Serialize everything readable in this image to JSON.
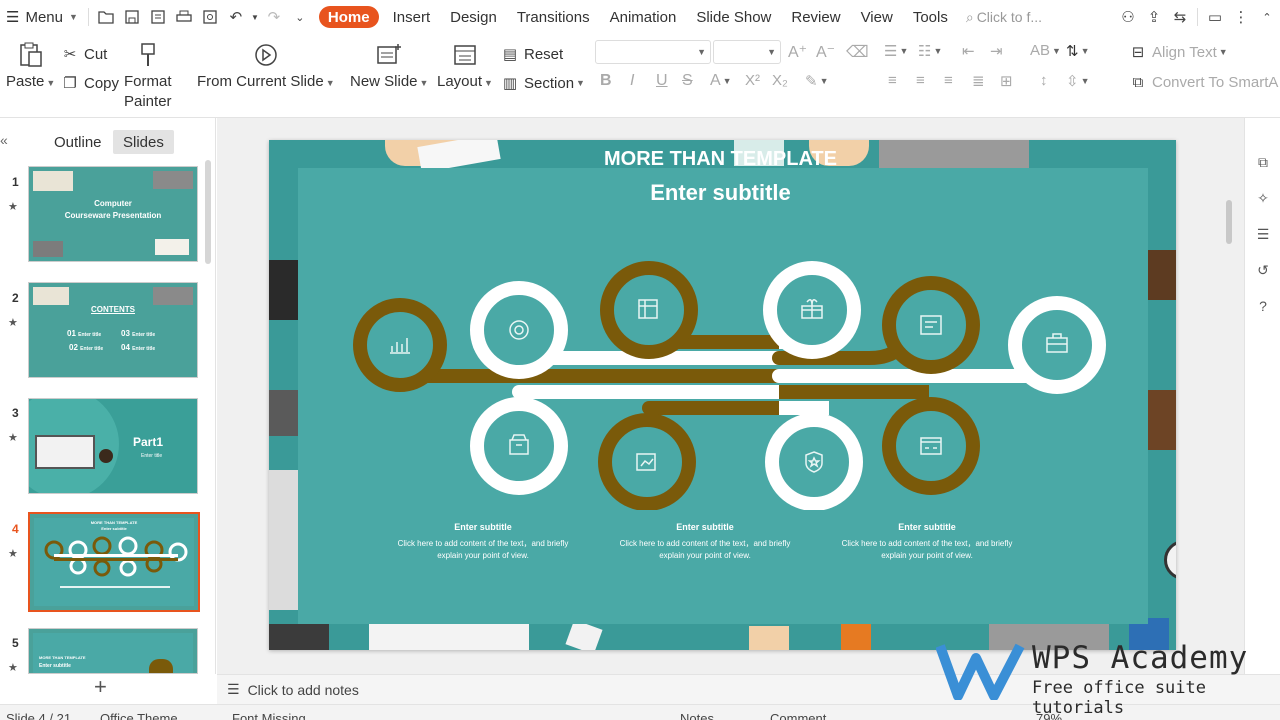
{
  "menubar": {
    "menu_label": "Menu",
    "tabs": [
      "Home",
      "Insert",
      "Design",
      "Transitions",
      "Animation",
      "Slide Show",
      "Review",
      "View",
      "Tools"
    ],
    "search_placeholder": "Click to f..."
  },
  "ribbon": {
    "paste": "Paste",
    "cut": "Cut",
    "copy": "Copy",
    "format_painter_1": "Format",
    "format_painter_2": "Painter",
    "from_current_slide": "From Current Slide",
    "new_slide": "New Slide",
    "layout": "Layout",
    "reset": "Reset",
    "section": "Section",
    "align_text": "Align Text",
    "convert_smartart": "Convert To SmartA"
  },
  "left_panel": {
    "tab_outline": "Outline",
    "tab_slides": "Slides",
    "thumbs": [
      {
        "num": "1",
        "title": "Computer",
        "title2": "Courseware Presentation"
      },
      {
        "num": "2",
        "title": "CONTENTS",
        "items": [
          "01",
          "Enter title",
          "03",
          "Enter title",
          "02",
          "Enter title",
          "04",
          "Enter title"
        ]
      },
      {
        "num": "3",
        "title": "Part1",
        "sub": "Enter title"
      },
      {
        "num": "4",
        "title": "MORE THAN TEMPLATE",
        "sub": "Enter subtitle"
      },
      {
        "num": "5",
        "title": "MORE THAN TEMPLATE",
        "sub": "Enter subtitle"
      }
    ]
  },
  "slide": {
    "title": "MORE THAN TEMPLATE",
    "subtitle": "Enter subtitle",
    "notes": [
      {
        "heading": "Enter subtitle",
        "line1": "Click here to add content of the text，and briefly",
        "line2": "explain your point of view."
      },
      {
        "heading": "Enter subtitle",
        "line1": "Click here to add content of the text，and briefly",
        "line2": "explain your point of view."
      },
      {
        "heading": "Enter subtitle",
        "line1": "Click here to add content of the text，and briefly",
        "line2": "explain your point of view."
      }
    ],
    "colors": {
      "teal": "#4aa9a6",
      "dark_teal": "#3a9a98",
      "brown": "#7a5a0a",
      "white": "#ffffff"
    }
  },
  "notes_bar": {
    "placeholder": "Click to add notes"
  },
  "status": {
    "slide_count": "Slide 4 / 21",
    "theme": "Office Theme",
    "font": "Font Missing",
    "notes": "Notes",
    "comment": "Comment",
    "zoom": "79%"
  },
  "watermark": {
    "title": "WPS Academy",
    "subtitle": "Free office suite tutorials"
  }
}
